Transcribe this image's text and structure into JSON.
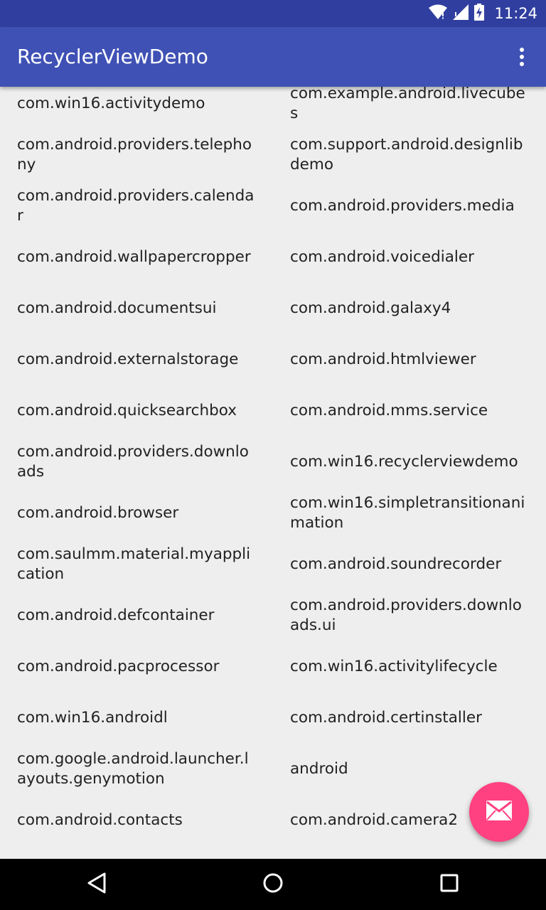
{
  "status_bar": {
    "time": "11:24",
    "icons": [
      "wifi-icon",
      "signal-icon",
      "battery-charging-icon"
    ],
    "color": "#303f9f"
  },
  "app_bar": {
    "title": "RecyclerViewDemo",
    "menu_icon": "more-vert-icon",
    "color": "#3f51b5"
  },
  "list": {
    "items": [
      "com.win16.activitydemo",
      "com.example.android.livecubes",
      "com.android.providers.telephony",
      "com.support.android.designlibdemo",
      "com.android.providers.calendar",
      "com.android.providers.media",
      "com.android.wallpapercropper",
      "com.android.voicedialer",
      "com.android.documentsui",
      "com.android.galaxy4",
      "com.android.externalstorage",
      "com.android.htmlviewer",
      "com.android.quicksearchbox",
      "com.android.mms.service",
      "com.android.providers.downloads",
      "com.win16.recyclerviewdemo",
      "com.android.browser",
      "com.win16.simpletransitionanimation",
      "com.saulmm.material.myapplication",
      "com.android.soundrecorder",
      "com.android.defcontainer",
      "com.android.providers.downloads.ui",
      "com.android.pacprocessor",
      "com.win16.activitylifecycle",
      "com.win16.androidl",
      "com.android.certinstaller",
      "com.google.android.launcher.layouts.genymotion",
      "android",
      "com.android.contacts",
      "com.android.camera2"
    ]
  },
  "fab": {
    "icon": "email-icon",
    "color": "#ff4081"
  },
  "nav_bar": {
    "icons": [
      "back-icon",
      "home-icon",
      "recents-icon"
    ]
  }
}
